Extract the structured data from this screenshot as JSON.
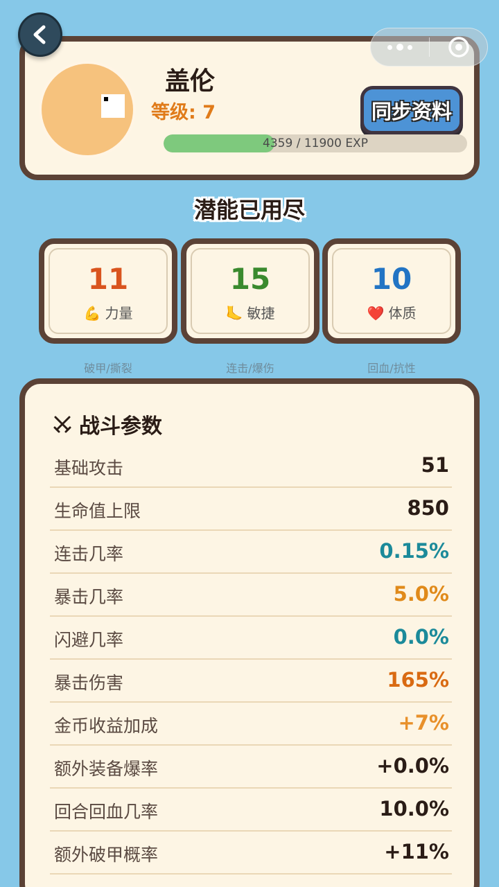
{
  "header": {
    "player_name": "盖伦",
    "level": "等级: 7",
    "sync_label": "同步资料",
    "exp": {
      "current": 4359,
      "max": 11900,
      "text": "4359 / 11900 EXP",
      "progress": 0.366
    }
  },
  "capsule": {
    "more_icon": "more-dots-icon",
    "close_icon": "target-circle-icon"
  },
  "potential": {
    "title": "潜能已用尽"
  },
  "stats": [
    {
      "value": "11",
      "label": "力量",
      "icon": "💪",
      "icon_name": "muscle-icon",
      "color": "#d9541e",
      "desc": "破甲/撕裂"
    },
    {
      "value": "15",
      "label": "敏捷",
      "icon": "🦶",
      "icon_name": "foot-icon",
      "color": "#3a8a2e",
      "desc": "连击/爆伤"
    },
    {
      "value": "10",
      "label": "体质",
      "icon": "❤️",
      "icon_name": "heart-icon",
      "color": "#2274c4",
      "desc": "回血/抗性"
    }
  ],
  "combat": {
    "title": "战斗参数",
    "rows": [
      {
        "label": "基础攻击",
        "value": "51",
        "color": "#2a1c16"
      },
      {
        "label": "生命值上限",
        "value": "850",
        "color": "#2a1c16"
      },
      {
        "label": "连击几率",
        "value": "0.15%",
        "color": "#1b8a9a"
      },
      {
        "label": "暴击几率",
        "value": "5.0%",
        "color": "#e08a1a"
      },
      {
        "label": "闪避几率",
        "value": "0.0%",
        "color": "#1b8a9a"
      },
      {
        "label": "暴击伤害",
        "value": "165%",
        "color": "#d96a12"
      },
      {
        "label": "金币收益加成",
        "value": "+7%",
        "color": "#e8902a"
      },
      {
        "label": "额外装备爆率",
        "value": "+0.0%",
        "color": "#2a1c16"
      },
      {
        "label": "回合回血几率",
        "value": "10.0%",
        "color": "#2a1c16"
      },
      {
        "label": "额外破甲概率",
        "value": "+11%",
        "color": "#2a1c16"
      }
    ]
  }
}
